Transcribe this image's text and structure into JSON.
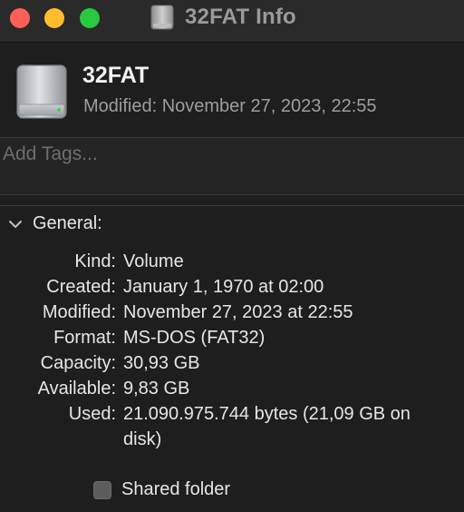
{
  "window": {
    "title": "32FAT Info",
    "title_icon": "external-drive-icon"
  },
  "header": {
    "volume_name": "32FAT",
    "modified": "Modified: November 27, 2023, 22:55",
    "icon": "external-drive-icon"
  },
  "tags": {
    "placeholder": "Add Tags...",
    "value": ""
  },
  "general": {
    "label": "General:",
    "expanded": true,
    "rows": [
      {
        "key": "Kind:",
        "value": "Volume"
      },
      {
        "key": "Created:",
        "value": "January 1, 1970 at 02:00"
      },
      {
        "key": "Modified:",
        "value": "November 27, 2023 at 22:55"
      },
      {
        "key": "Format:",
        "value": "MS-DOS (FAT32)"
      },
      {
        "key": "Capacity:",
        "value": "30,93 GB"
      },
      {
        "key": "Available:",
        "value": "9,83 GB"
      },
      {
        "key": "Used:",
        "value": "21.090.975.744 bytes (21,09 GB on disk)"
      }
    ]
  },
  "shared_folder": {
    "label": "Shared folder",
    "checked": false
  },
  "colors": {
    "close": "#fe5f57",
    "minimize": "#febc2e",
    "maximize": "#28c840",
    "background": "#1e1e1e"
  }
}
